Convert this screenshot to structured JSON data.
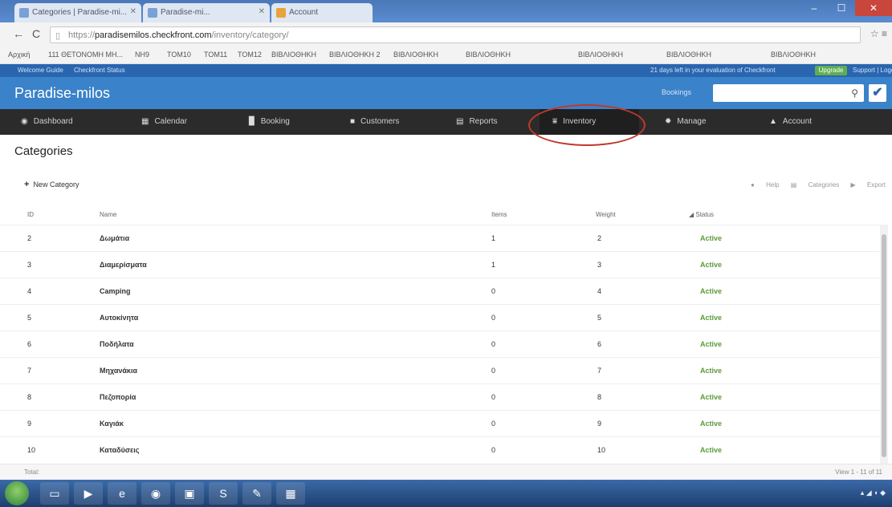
{
  "browser": {
    "tabs": [
      {
        "label": "Categories | Paradise-mi..."
      },
      {
        "label": "Paradise-mi..."
      },
      {
        "label": "Account"
      }
    ],
    "address": {
      "scheme": "https://",
      "host": "paradisemilos.checkfront.com",
      "path": "/inventory/category/"
    },
    "bookmarks": [
      "Αρχική",
      "111 ΘΕΤΟΝΟΜΗ ΜΗ...",
      "ΝΗ9",
      "ΤΟΜ10",
      "ΤΟΜ11",
      "ΤΟΜ12",
      "ΒΙΒΛΙΟΘΗΚΗ",
      "ΒΙΒΛΙΟΘΗΚΗ 2",
      "ΒΙΒΛΙΟΘΗΚΗ",
      "ΒΙΒΛΙΟΘΗΚΗ",
      "ΒΙΒΛΙΟΘΗΚΗ",
      "ΒΙΒΛΙΟΘΗΚΗ",
      "ΒΙΒΛΙΟΘΗΚΗ"
    ]
  },
  "cf_topbar": {
    "left_items": [
      "Welcome Guide",
      "Checkfront Status"
    ],
    "trial_text": "21 days left in your evaluation of Checkfront",
    "upgrade_label": "Upgrade",
    "support_label": "Support | Logout"
  },
  "header": {
    "brand": "Paradise-milos",
    "search_label": "Bookings",
    "check_glyph": "✔"
  },
  "nav": {
    "items": [
      {
        "label": "Dashboard",
        "icon": "dashboard-icon",
        "glyph": "◉"
      },
      {
        "label": "Calendar",
        "icon": "calendar-icon",
        "glyph": "▦"
      },
      {
        "label": "Booking",
        "icon": "booking-icon",
        "glyph": "▉"
      },
      {
        "label": "Customers",
        "icon": "customers-icon",
        "glyph": "■"
      },
      {
        "label": "Reports",
        "icon": "reports-icon",
        "glyph": "▤"
      },
      {
        "label": "Inventory",
        "icon": "inventory-icon",
        "glyph": "⩸"
      },
      {
        "label": "Manage",
        "icon": "manage-icon",
        "glyph": "✹"
      },
      {
        "label": "Account",
        "icon": "account-icon",
        "glyph": "▲"
      }
    ],
    "active": "Inventory"
  },
  "page": {
    "title": "Categories",
    "new_category_label": "New Category",
    "actions": [
      "Help",
      "Categories",
      "Export"
    ]
  },
  "table": {
    "columns": [
      "ID",
      "Name",
      "Items",
      "Weight",
      "Status"
    ],
    "rows": [
      {
        "id": "2",
        "name": "Δωμάτια",
        "items": "1",
        "weight": "2",
        "status": "Active"
      },
      {
        "id": "3",
        "name": "Διαμερίσματα",
        "items": "1",
        "weight": "3",
        "status": "Active"
      },
      {
        "id": "4",
        "name": "Camping",
        "items": "0",
        "weight": "4",
        "status": "Active"
      },
      {
        "id": "5",
        "name": "Αυτοκίνητα",
        "items": "0",
        "weight": "5",
        "status": "Active"
      },
      {
        "id": "6",
        "name": "Ποδήλατα",
        "items": "0",
        "weight": "6",
        "status": "Active"
      },
      {
        "id": "7",
        "name": "Μηχανάκια",
        "items": "0",
        "weight": "7",
        "status": "Active"
      },
      {
        "id": "8",
        "name": "Πεζοπορία",
        "items": "0",
        "weight": "8",
        "status": "Active"
      },
      {
        "id": "9",
        "name": "Καγιάκ",
        "items": "0",
        "weight": "9",
        "status": "Active"
      },
      {
        "id": "10",
        "name": "Καταδύσεις",
        "items": "0",
        "weight": "10",
        "status": "Active"
      }
    ],
    "total_label": "Total:",
    "view_label": "View 1 - 11 of 11"
  },
  "colors": {
    "header_blue": "#3a82c9",
    "nav_dark": "#2b2b2b",
    "status_green": "#5a9a3a",
    "annotation_red": "#c0392b"
  }
}
